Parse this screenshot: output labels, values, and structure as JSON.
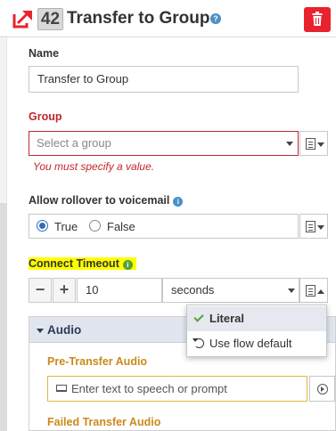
{
  "header": {
    "number": "42",
    "title": "Transfer to Group"
  },
  "form": {
    "name": {
      "label": "Name",
      "value": "Transfer to Group"
    },
    "group": {
      "label": "Group",
      "placeholder": "Select a group",
      "error": "You must specify a value."
    },
    "rollover": {
      "label": "Allow rollover to voicemail",
      "options": [
        "True",
        "False"
      ],
      "selected": "True"
    },
    "timeout": {
      "label": "Connect Timeout",
      "value": "10",
      "unit": "seconds",
      "minus": "−",
      "plus": "+"
    }
  },
  "dropdown": {
    "items": [
      {
        "label": "Literal",
        "selected": true
      },
      {
        "label": "Use flow default",
        "selected": false
      }
    ]
  },
  "audio": {
    "title": "Audio",
    "pre_transfer_label": "Pre-Transfer Audio",
    "prompt_placeholder": "Enter text to speech or prompt",
    "failed_transfer_label": "Failed Transfer Audio"
  },
  "colors": {
    "delete": "#e8232d",
    "error": "#c0282d",
    "highlight": "#ffff00",
    "audio_label": "#c98a1a",
    "accent": "#2f6db5"
  }
}
